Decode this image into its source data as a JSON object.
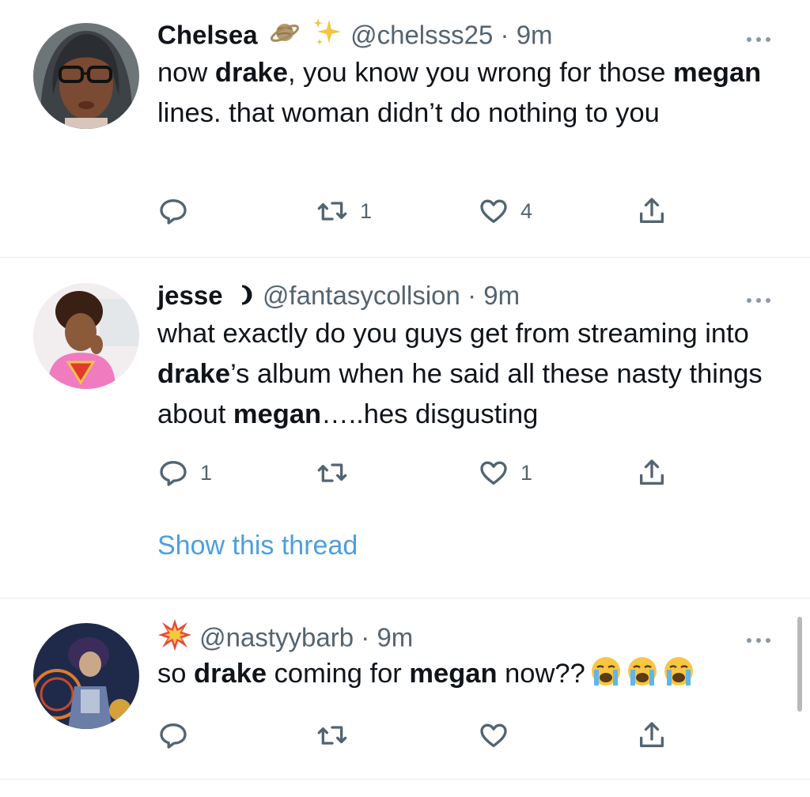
{
  "tweets": [
    {
      "name": "Chelsea",
      "handle": "@chelsss25",
      "dot": "·",
      "time": "9m",
      "segments": [
        {
          "t": "now "
        },
        {
          "t": "drake",
          "b": true
        },
        {
          "t": ", you know you wrong for those "
        },
        {
          "t": "megan",
          "b": true
        },
        {
          "t": " lines. that woman didn’t do nothing to you"
        }
      ],
      "reply_count": "",
      "retweet_count": "1",
      "like_count": "4"
    },
    {
      "name": "jesse",
      "handle": "@fantasycollsion",
      "dot": "·",
      "time": "9m",
      "segments": [
        {
          "t": "what exactly do you guys get from streaming into "
        },
        {
          "t": "drake",
          "b": true
        },
        {
          "t": "’s album when he said all these nasty things about "
        },
        {
          "t": "megan",
          "b": true
        },
        {
          "t": "…..hes disgusting"
        }
      ],
      "reply_count": "1",
      "retweet_count": "",
      "like_count": "1",
      "show_thread": "Show this thread"
    },
    {
      "name": "",
      "handle": "@nastyybarb",
      "dot": "·",
      "time": "9m",
      "segments": [
        {
          "t": "so "
        },
        {
          "t": "drake",
          "b": true
        },
        {
          "t": " coming for "
        },
        {
          "t": "megan",
          "b": true
        },
        {
          "t": " now??"
        }
      ],
      "reply_count": "",
      "retweet_count": "",
      "like_count": ""
    }
  ],
  "icons": {
    "reply": "reply-icon",
    "retweet": "retweet-icon",
    "like": "heart-icon",
    "share": "share-icon",
    "more": "more-icon"
  },
  "colors": {
    "text": "#0f1419",
    "secondary": "#536471",
    "link": "#4d9fdb",
    "divider": "#e6ecf0"
  }
}
